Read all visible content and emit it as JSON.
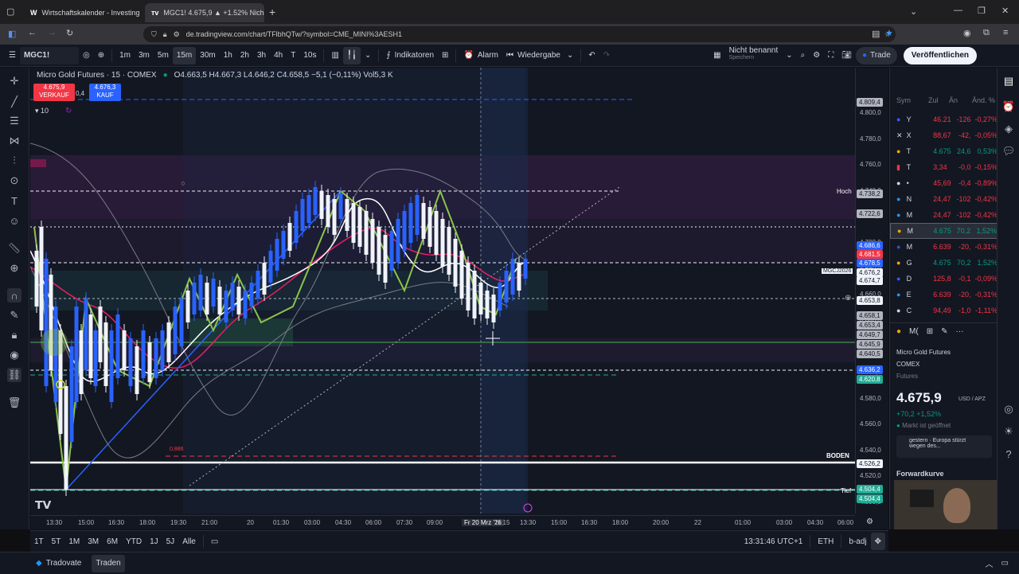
{
  "browser": {
    "tabs": [
      {
        "label": "Wirtschaftskalender - Investing",
        "icon": "investing-icon"
      },
      {
        "label": "MGC1! 4.675,9 ▲ +1.52% Nich",
        "icon": "tradingview-icon"
      }
    ],
    "url": "de.tradingview.com/chart/TFlbhQTw/?symbol=CME_MINI%3AESH1"
  },
  "header": {
    "symbol": "MGC1!",
    "intervals": [
      "1m",
      "3m",
      "5m",
      "15m",
      "30m",
      "1h",
      "2h",
      "3h",
      "4h",
      "T",
      "10s"
    ],
    "selected_interval": "15m",
    "indicators_label": "Indikatoren",
    "alarm_label": "Alarm",
    "replay_label": "Wiedergabe",
    "layout_name": "Nicht benannt",
    "layout_sub": "Speichern",
    "trade_label": "Trade",
    "publish_label": "Veröffentlichen"
  },
  "chart": {
    "title": "Micro Gold Futures · 15 · COMEX",
    "ohlc": "O4.663,5 H4.667,3 L4.646,2 C4.658,5 −5,1 (−0,11%) Vol5,3 K",
    "sell_price": "4.675,9",
    "sell_label": "VERKAUF",
    "spread": "0,4",
    "buy_price": "4.676,3",
    "buy_label": "KAUF",
    "indicator_count": "10",
    "labels": {
      "hoch": "Hoch",
      "boden": "BODEN",
      "tief": "Tief",
      "fib_886": "0,886",
      "fib_0": "0",
      "mgcj": "MGCJ2026"
    },
    "price_axis": [
      "4.800,0",
      "4.780,0",
      "4.760,0",
      "4.740,0",
      "4.720,0",
      "4.700,0",
      "4.680,0",
      "4.660,0",
      "4.640,0",
      "4.620,0",
      "4.600,0",
      "4.580,0",
      "4.560,0",
      "4.540,0",
      "4.520,0",
      "4.500,0"
    ],
    "price_tags": [
      {
        "text": "4.809,4",
        "color": "#b2b5be"
      },
      {
        "text": "4.738,2",
        "color": "#b2b5be"
      },
      {
        "text": "4.722,6",
        "color": "#b2b5be"
      },
      {
        "text": "4.686,6",
        "color": "#2962ff"
      },
      {
        "text": "4.681,5",
        "color": "#f23645"
      },
      {
        "text": "4.678,5",
        "color": "#2962ff"
      },
      {
        "text": "4.676,2",
        "color": "#f0f3fa"
      },
      {
        "text": "4.674,7",
        "color": "#f0f3fa"
      },
      {
        "text": "4.653,8",
        "color": "#f0f3fa"
      },
      {
        "text": "4.658,1",
        "color": "#b2b5be"
      },
      {
        "text": "4.653,4",
        "color": "#b2b5be"
      },
      {
        "text": "4.649,7",
        "color": "#b2b5be"
      },
      {
        "text": "4.645,9",
        "color": "#b2b5be"
      },
      {
        "text": "4.640,5",
        "color": "#b2b5be"
      },
      {
        "text": "4.636,2",
        "color": "#2962ff"
      },
      {
        "text": "4.620,8",
        "color": "#22ab94"
      },
      {
        "text": "4.526,2",
        "color": "#f0f3fa"
      },
      {
        "text": "4.504,4",
        "color": "#22ab94"
      },
      {
        "text": "4.504,4",
        "color": "#22ab94"
      }
    ],
    "time_axis": [
      "13:30",
      "15:00",
      "16:30",
      "18:00",
      "19:30",
      "21:00",
      "20",
      "01:30",
      "03:00",
      "04:30",
      "06:00",
      "07:30",
      "09:00",
      "Fr 20 Mrz '26",
      "11:15",
      "13:30",
      "15:00",
      "16:30",
      "18:00",
      "20:00",
      "22",
      "01:00",
      "03:00",
      "04:30",
      "06:00"
    ]
  },
  "watchlist": {
    "headers": [
      "Sym",
      "Zul",
      "Än",
      "Änd. %"
    ],
    "rows": [
      {
        "sym": "Y",
        "last": "46.21",
        "chg": "-126",
        "pct": "-0,27%",
        "dir": "down",
        "icon": "crypto-icon"
      },
      {
        "sym": "X",
        "last": "88,67",
        "chg": "-42,",
        "pct": "-0,05%",
        "dir": "down",
        "icon": "x-icon"
      },
      {
        "sym": "T",
        "last": "4.675",
        "chg": "24,6",
        "pct": "0,53%",
        "dir": "up",
        "icon": "gold-icon"
      },
      {
        "sym": "T",
        "last": "3,34",
        "chg": "-0,0",
        "pct": "-0,15%",
        "dir": "down",
        "icon": "flag-icon"
      },
      {
        "sym": "•",
        "last": "45,69",
        "chg": "-0,4",
        "pct": "-0,89%",
        "dir": "down",
        "icon": "silver-icon"
      },
      {
        "sym": "N",
        "last": "24,47",
        "chg": "-102",
        "pct": "-0,42%",
        "dir": "down",
        "icon": "index-icon"
      },
      {
        "sym": "M",
        "last": "24,47",
        "chg": "-102",
        "pct": "-0,42%",
        "dir": "down",
        "icon": "index-icon"
      },
      {
        "sym": "M",
        "last": "4.675",
        "chg": "70,2",
        "pct": "1,52%",
        "dir": "up",
        "icon": "gold-icon",
        "selected": true
      },
      {
        "sym": "M",
        "last": "6.639",
        "chg": "-20,",
        "pct": "-0,31%",
        "dir": "down",
        "icon": "us-flag-icon"
      },
      {
        "sym": "G",
        "last": "4.675",
        "chg": "70,2",
        "pct": "1,52%",
        "dir": "up",
        "icon": "gold-icon"
      },
      {
        "sym": "D",
        "last": "125,8",
        "chg": "-0,1",
        "pct": "-0,09%",
        "dir": "down",
        "icon": "bond-icon"
      },
      {
        "sym": "E",
        "last": "6.639",
        "chg": "-20,",
        "pct": "-0,31%",
        "dir": "down",
        "icon": "index-icon"
      },
      {
        "sym": "C",
        "last": "94,49",
        "chg": "-1,0",
        "pct": "-1,11%",
        "dir": "down",
        "icon": "oil-icon"
      }
    ]
  },
  "details": {
    "sym_short": "M(",
    "name": "Micro Gold Futures",
    "exchange": "COMEX",
    "type": "Futures",
    "price": "4.675,9",
    "unit": "USD / APZ",
    "change": "+70,2 +1,52%",
    "status": "Markt ist geöffnet",
    "news": "gestern · Europa stürzt wegen des...",
    "forward": "Forwardkurve"
  },
  "bottombar": {
    "ranges": [
      "1T",
      "5T",
      "1M",
      "3M",
      "6M",
      "YTD",
      "1J",
      "5J",
      "Alle"
    ],
    "clock": "13:31:46 UTC+1",
    "session": "ETH",
    "adj": "b-adj"
  },
  "footer": {
    "broker": "Tradovate",
    "trade": "Traden"
  }
}
